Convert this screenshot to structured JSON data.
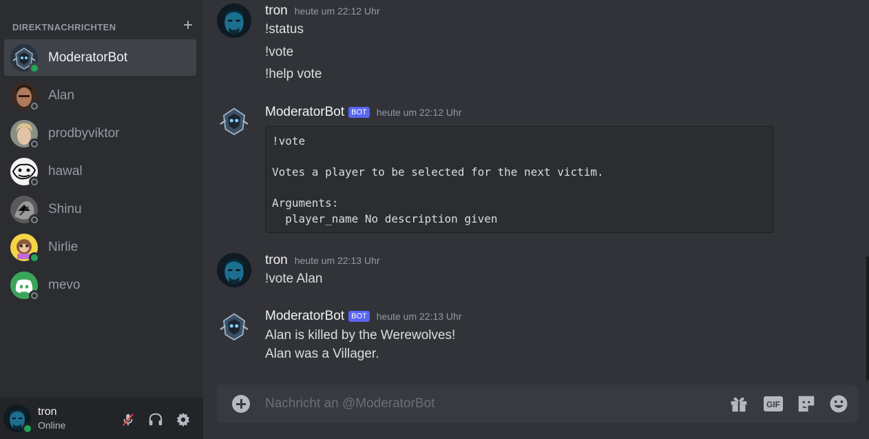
{
  "sidebar": {
    "section_title": "DIREKTNACHRICHTEN",
    "add_icon": "plus-icon",
    "items": [
      {
        "name": "ModeratorBot",
        "status": "online",
        "active": true
      },
      {
        "name": "Alan",
        "status": "offline"
      },
      {
        "name": "prodbyviktor",
        "status": "offline"
      },
      {
        "name": "hawal",
        "status": "offline"
      },
      {
        "name": "Shinu",
        "status": "offline"
      },
      {
        "name": "Nirlie",
        "status": "online"
      },
      {
        "name": "mevo",
        "status": "offline"
      }
    ]
  },
  "user_panel": {
    "name": "tron",
    "status": "Online",
    "icons": [
      "mute-microphone-icon",
      "headphones-icon",
      "settings-gear-icon"
    ]
  },
  "messages": [
    {
      "author": "tron",
      "time": "heute um 22:12 Uhr",
      "lines": [
        "!status",
        "!vote",
        "!help vote"
      ]
    },
    {
      "author": "ModeratorBot",
      "bot_tag": "BOT",
      "time": "heute um 22:12 Uhr",
      "code": "!vote\n\nVotes a player to be selected for the next victim.\n\nArguments:\n  player_name No description given"
    },
    {
      "author": "tron",
      "time": "heute um 22:13 Uhr",
      "lines": [
        "!vote Alan"
      ]
    },
    {
      "author": "ModeratorBot",
      "bot_tag": "BOT",
      "time": "heute um 22:13 Uhr",
      "lines": [
        "Alan is killed by the Werewolves!",
        "Alan was a Villager."
      ]
    }
  ],
  "composer": {
    "placeholder": "Nachricht an @ModeratorBot",
    "gif_label": "GIF",
    "icons": [
      "add-attachment-icon",
      "gift-icon",
      "gif-icon",
      "sticker-icon",
      "emoji-icon"
    ]
  },
  "colors": {
    "background": "#313338",
    "sidebar": "#2b2d31",
    "accent": "#5865f2",
    "online": "#23a55a",
    "offline": "#80848e"
  }
}
